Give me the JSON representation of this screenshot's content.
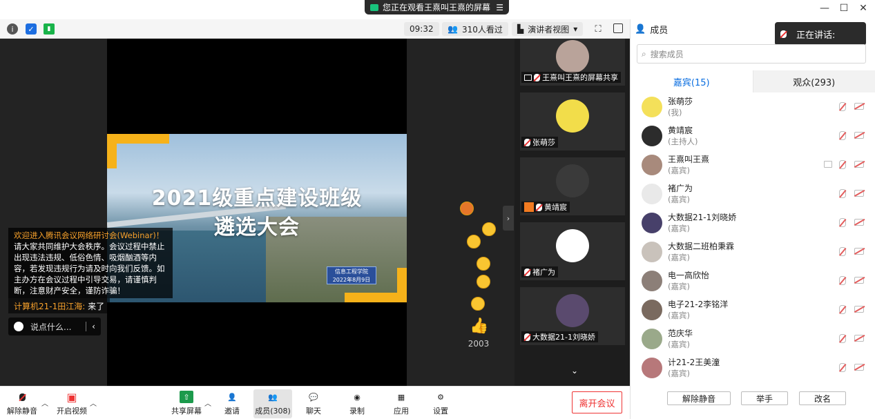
{
  "title_bar": {
    "share_notice": "您正在观看王熹叫王熹的屏幕",
    "menu_icon": "list-icon",
    "window_controls": [
      "minimize",
      "maximize",
      "close"
    ]
  },
  "toolbar": {
    "elapsed": "09:32",
    "viewers": "310人看过",
    "view_mode": "演讲者视图",
    "icons": [
      "info-icon",
      "shield-icon",
      "signal-icon",
      "fullscreen-icon",
      "layout-icon"
    ]
  },
  "slide": {
    "title_line1": "2021级重点建设班级",
    "title_line2": "遴选大会",
    "badge_line1": "信息工程学院",
    "badge_line2": "2022年8月9日"
  },
  "chat": {
    "notice_title": "欢迎进入腾讯会议网络研讨会(Webinar)！",
    "notice_body": "请大家共同维护大会秩序。会议过程中禁止出现违法违规、低俗色情、吸烟酗酒等内容，若发现违规行为请及时向我们反馈。如主办方在会议过程中引导交易，请谨慎判断，注意财产安全，谨防诈骗！",
    "last_sender": "计算机21-1田江海:",
    "last_message": "来了",
    "input_placeholder": "说点什么..."
  },
  "reactions": {
    "like_count": "2003"
  },
  "thumbnails": [
    {
      "name": "王熹叫王熹的屏幕共享",
      "avatar_color": "#b9a39a"
    },
    {
      "name": "张萌莎",
      "avatar_color": "#f2dd4a"
    },
    {
      "name": "黄靖宸",
      "avatar_color": "#3a3a3a"
    },
    {
      "name": "褚广为",
      "avatar_color": "#ffffff"
    },
    {
      "name": "大数据21-1刘晓娇",
      "avatar_color": "#5a4a6e"
    }
  ],
  "bottom_bar": {
    "unmute": "解除静音",
    "start_video": "开启视频",
    "share_screen": "共享屏幕",
    "invite": "邀请",
    "members": "成员(308)",
    "chat": "聊天",
    "record": "录制",
    "apps": "应用",
    "settings": "设置",
    "leave": "离开会议"
  },
  "members_panel": {
    "title": "成员",
    "speaking_label": "正在讲话:",
    "search_placeholder": "搜索成员",
    "tab_guests": "嘉宾(15)",
    "tab_audience": "观众(293)",
    "members": [
      {
        "name": "张萌莎",
        "role": "(我)",
        "color": "#f4e05a",
        "sharing": false
      },
      {
        "name": "黄靖宸",
        "role": "(主持人)",
        "color": "#2c2c2c",
        "sharing": false
      },
      {
        "name": "王熹叫王熹",
        "role": "(嘉宾)",
        "color": "#a88a7c",
        "sharing": true
      },
      {
        "name": "褚广为",
        "role": "(嘉宾)",
        "color": "#e9e9e9",
        "sharing": false
      },
      {
        "name": "大数据21-1刘晓娇",
        "role": "(嘉宾)",
        "color": "#47406a",
        "sharing": false
      },
      {
        "name": "大数据二班柏秉霖",
        "role": "(嘉宾)",
        "color": "#c9c2bb",
        "sharing": false
      },
      {
        "name": "电一高欣怡",
        "role": "(嘉宾)",
        "color": "#8c7f78",
        "sharing": false
      },
      {
        "name": "电子21-2李铭洋",
        "role": "(嘉宾)",
        "color": "#7a6a5f",
        "sharing": false
      },
      {
        "name": "范庆华",
        "role": "(嘉宾)",
        "color": "#9aa98a",
        "sharing": false
      },
      {
        "name": "计21-2王美潼",
        "role": "(嘉宾)",
        "color": "#b7787a",
        "sharing": false
      }
    ],
    "btn_unmute": "解除静音",
    "btn_raise_hand": "举手",
    "btn_rename": "改名"
  },
  "colors": {
    "accent_blue": "#0a6ee0",
    "leave_red": "#e33333",
    "chat_orange": "#f7a12b"
  }
}
